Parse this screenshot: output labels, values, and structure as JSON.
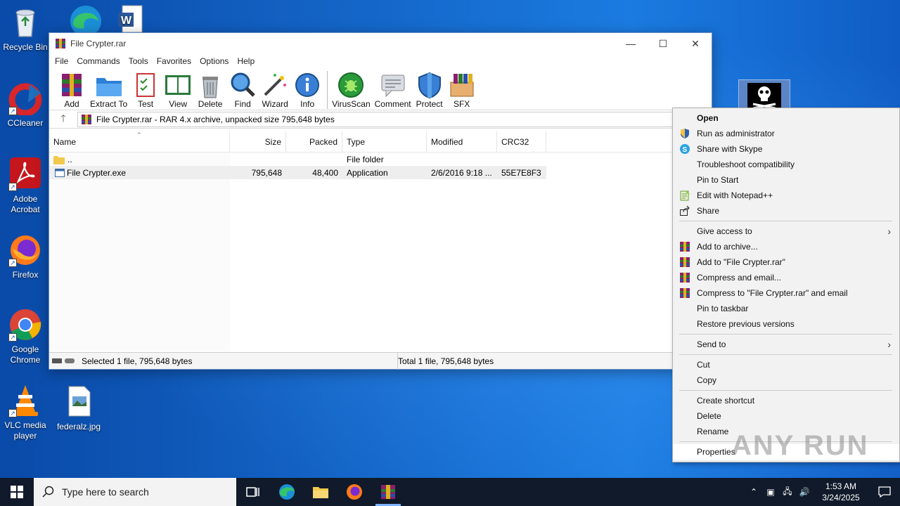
{
  "desktop": {
    "icons": [
      {
        "label": "Recycle Bin"
      },
      {
        "label": "CCleaner"
      },
      {
        "label": "Adobe Acrobat"
      },
      {
        "label": "Firefox"
      },
      {
        "label": "Google Chrome"
      },
      {
        "label": "VLC media player"
      },
      {
        "label": "federalz.jpg"
      }
    ],
    "watermark": "ANY RUN"
  },
  "window": {
    "title": "File Crypter.rar",
    "menu": [
      "File",
      "Commands",
      "Tools",
      "Favorites",
      "Options",
      "Help"
    ],
    "toolbar": [
      "Add",
      "Extract To",
      "Test",
      "View",
      "Delete",
      "Find",
      "Wizard",
      "Info",
      "VirusScan",
      "Comment",
      "Protect",
      "SFX"
    ],
    "path_text": "File Crypter.rar - RAR 4.x archive, unpacked size 795,648 bytes",
    "columns": [
      "Name",
      "Size",
      "Packed",
      "Type",
      "Modified",
      "CRC32"
    ],
    "rows": [
      {
        "name": "..",
        "size": "",
        "packed": "",
        "type": "File folder",
        "modified": "",
        "crc": ""
      },
      {
        "name": "File Crypter.exe",
        "size": "795,648",
        "packed": "48,400",
        "type": "Application",
        "modified": "2/6/2016 9:18 ...",
        "crc": "55E7E8F3"
      }
    ],
    "status_left": "Selected 1 file, 795,648 bytes",
    "status_right": "Total 1 file, 795,648 bytes"
  },
  "context_menu": {
    "items": [
      "Open",
      "Run as administrator",
      "Share with Skype",
      "Troubleshoot compatibility",
      "Pin to Start",
      "Edit with Notepad++",
      "Share",
      "Give access to",
      "Add to archive...",
      "Add to \"File Crypter.rar\"",
      "Compress and email...",
      "Compress to \"File Crypter.rar\" and email",
      "Pin to taskbar",
      "Restore previous versions",
      "Send to",
      "Cut",
      "Copy",
      "Create shortcut",
      "Delete",
      "Rename",
      "Properties"
    ]
  },
  "taskbar": {
    "search_placeholder": "Type here to search",
    "time": "1:53 AM",
    "date": "3/24/2025"
  },
  "colors": {
    "desktop_blue": "#1466c8",
    "taskbar": "#101a2a",
    "menu_bg": "#f2f2f2"
  }
}
